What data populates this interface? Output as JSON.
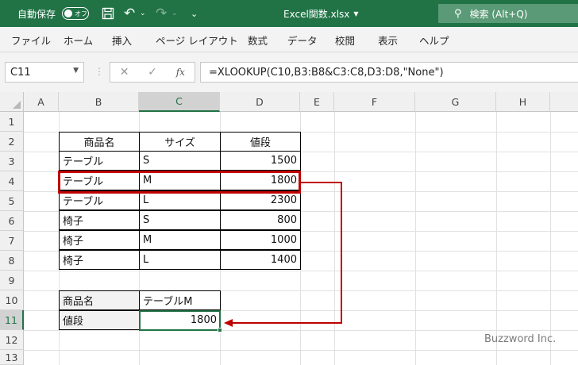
{
  "titlebar": {
    "autosave_label": "自動保存",
    "autosave_state": "オフ",
    "file_name": "Excel関数.xlsx",
    "search_label": "検索 (Alt+Q)"
  },
  "menu": [
    "ファイル",
    "ホーム",
    "挿入",
    "ページ レイアウト",
    "数式",
    "データ",
    "校閲",
    "表示",
    "ヘルプ"
  ],
  "formula_bar": {
    "name_box": "C11",
    "cancel": "✕",
    "confirm": "✓",
    "fx": "fx",
    "formula": "=XLOOKUP(C10,B3:B8&C3:C8,D3:D8,\"None\")"
  },
  "columns": [
    "A",
    "B",
    "C",
    "D",
    "E",
    "F",
    "G",
    "H"
  ],
  "rows": [
    "1",
    "2",
    "3",
    "4",
    "5",
    "6",
    "7",
    "8",
    "9",
    "10",
    "11",
    "12",
    "13"
  ],
  "table": {
    "headers": [
      "商品名",
      "サイズ",
      "値段"
    ],
    "rows": [
      [
        "テーブル",
        "S",
        "1500"
      ],
      [
        "テーブル",
        "M",
        "1800"
      ],
      [
        "テーブル",
        "L",
        "2300"
      ],
      [
        "椅子",
        "S",
        "800"
      ],
      [
        "椅子",
        "M",
        "1000"
      ],
      [
        "椅子",
        "L",
        "1400"
      ]
    ]
  },
  "lookup": {
    "label1": "商品名",
    "value1": "テーブルM",
    "label2": "値段",
    "value2": "1800"
  },
  "colors": {
    "excel_green": "#217346",
    "highlight_red": "#c00000"
  },
  "watermark": "Buzzword Inc."
}
